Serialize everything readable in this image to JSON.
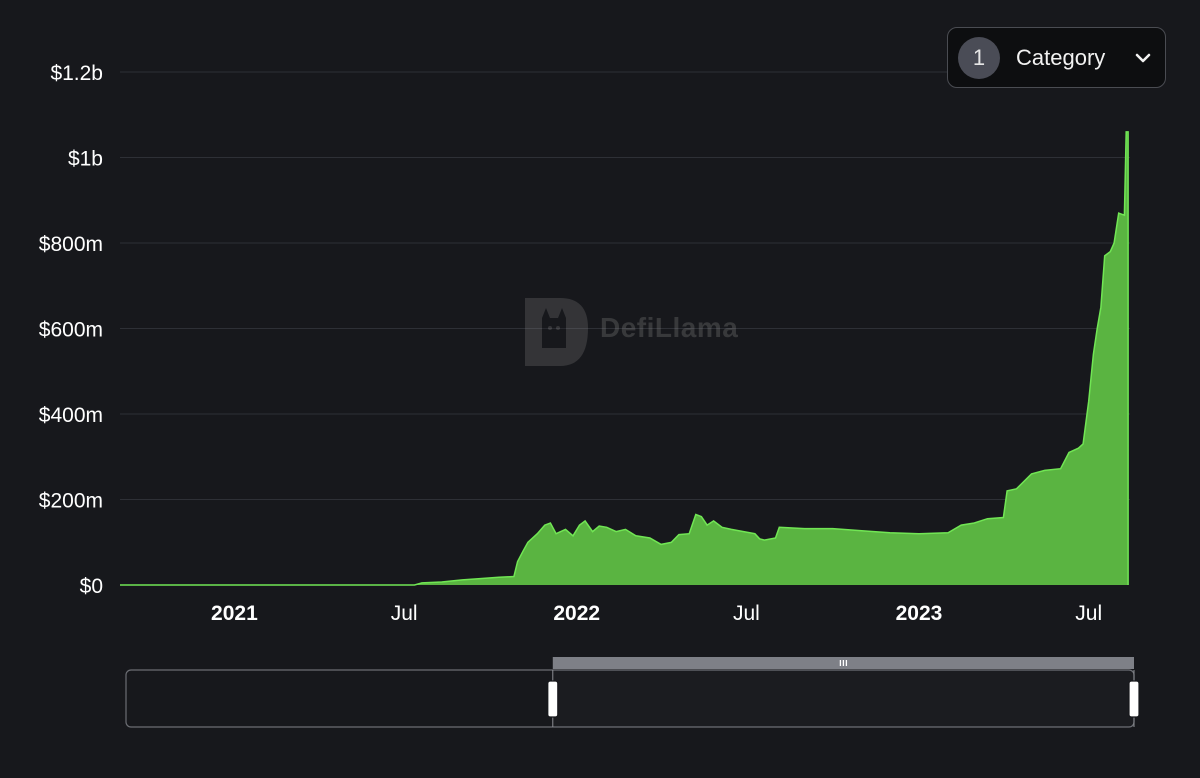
{
  "category_button": {
    "count": "1",
    "label": "Category"
  },
  "watermark": {
    "text": "DefiLlama"
  },
  "colors": {
    "background": "#17181c",
    "series_fill": "#5ab441",
    "series_line": "#71e654",
    "grid": "#2e3036",
    "tick_text": "#ffffff"
  },
  "chart_data": {
    "type": "area",
    "x_axis": {
      "min": "2020-09-01",
      "max": "2023-08-14",
      "ticks": [
        {
          "label": "2021",
          "date": "2021-01-01",
          "bold": true
        },
        {
          "label": "Jul",
          "date": "2021-07-01",
          "bold": false
        },
        {
          "label": "2022",
          "date": "2022-01-01",
          "bold": true
        },
        {
          "label": "Jul",
          "date": "2022-07-01",
          "bold": false
        },
        {
          "label": "2023",
          "date": "2023-01-01",
          "bold": true
        },
        {
          "label": "Jul",
          "date": "2023-07-01",
          "bold": false
        }
      ]
    },
    "y_axis": {
      "min": 0,
      "max": 1200000000,
      "ticks": [
        {
          "label": "$0",
          "value": 0
        },
        {
          "label": "$200m",
          "value": 200000000
        },
        {
          "label": "$400m",
          "value": 400000000
        },
        {
          "label": "$600m",
          "value": 600000000
        },
        {
          "label": "$800m",
          "value": 800000000
        },
        {
          "label": "$1b",
          "value": 1000000000
        },
        {
          "label": "$1.2b",
          "value": 1200000000
        }
      ]
    },
    "grid": true,
    "series": [
      {
        "points": [
          [
            "2020-09-01",
            0
          ],
          [
            "2021-07-12",
            0
          ],
          [
            "2021-07-20",
            5000000
          ],
          [
            "2021-08-10",
            7000000
          ],
          [
            "2021-09-01",
            12000000
          ],
          [
            "2021-09-20",
            15000000
          ],
          [
            "2021-10-10",
            18000000
          ],
          [
            "2021-10-26",
            20000000
          ],
          [
            "2021-10-30",
            55000000
          ],
          [
            "2021-11-05",
            80000000
          ],
          [
            "2021-11-10",
            100000000
          ],
          [
            "2021-11-20",
            120000000
          ],
          [
            "2021-11-28",
            140000000
          ],
          [
            "2021-12-04",
            145000000
          ],
          [
            "2021-12-10",
            120000000
          ],
          [
            "2021-12-20",
            130000000
          ],
          [
            "2021-12-28",
            115000000
          ],
          [
            "2022-01-04",
            140000000
          ],
          [
            "2022-01-10",
            150000000
          ],
          [
            "2022-01-18",
            125000000
          ],
          [
            "2022-01-25",
            138000000
          ],
          [
            "2022-02-02",
            135000000
          ],
          [
            "2022-02-12",
            125000000
          ],
          [
            "2022-02-22",
            130000000
          ],
          [
            "2022-03-05",
            115000000
          ],
          [
            "2022-03-20",
            110000000
          ],
          [
            "2022-04-01",
            95000000
          ],
          [
            "2022-04-12",
            100000000
          ],
          [
            "2022-04-20",
            118000000
          ],
          [
            "2022-05-01",
            120000000
          ],
          [
            "2022-05-08",
            165000000
          ],
          [
            "2022-05-14",
            160000000
          ],
          [
            "2022-05-20",
            140000000
          ],
          [
            "2022-05-27",
            150000000
          ],
          [
            "2022-06-05",
            135000000
          ],
          [
            "2022-06-15",
            130000000
          ],
          [
            "2022-06-28",
            125000000
          ],
          [
            "2022-07-10",
            120000000
          ],
          [
            "2022-07-15",
            108000000
          ],
          [
            "2022-07-20",
            105000000
          ],
          [
            "2022-08-01",
            110000000
          ],
          [
            "2022-08-05",
            135000000
          ],
          [
            "2022-09-01",
            132000000
          ],
          [
            "2022-10-01",
            132000000
          ],
          [
            "2022-11-01",
            127000000
          ],
          [
            "2022-12-01",
            122000000
          ],
          [
            "2023-01-01",
            120000000
          ],
          [
            "2023-02-01",
            122000000
          ],
          [
            "2023-02-15",
            140000000
          ],
          [
            "2023-03-01",
            145000000
          ],
          [
            "2023-03-15",
            155000000
          ],
          [
            "2023-04-01",
            158000000
          ],
          [
            "2023-04-05",
            220000000
          ],
          [
            "2023-04-15",
            225000000
          ],
          [
            "2023-05-01",
            260000000
          ],
          [
            "2023-05-15",
            268000000
          ],
          [
            "2023-06-01",
            272000000
          ],
          [
            "2023-06-10",
            310000000
          ],
          [
            "2023-06-20",
            320000000
          ],
          [
            "2023-06-25",
            330000000
          ],
          [
            "2023-07-01",
            430000000
          ],
          [
            "2023-07-06",
            540000000
          ],
          [
            "2023-07-10",
            600000000
          ],
          [
            "2023-07-14",
            650000000
          ],
          [
            "2023-07-18",
            770000000
          ],
          [
            "2023-07-24",
            780000000
          ],
          [
            "2023-07-28",
            800000000
          ],
          [
            "2023-08-02",
            870000000
          ],
          [
            "2023-08-08",
            865000000
          ],
          [
            "2023-08-10",
            1060000000
          ],
          [
            "2023-08-12",
            1060000000
          ]
        ]
      }
    ],
    "brush": {
      "start": "2021-12-01",
      "end": "2023-08-14"
    }
  }
}
